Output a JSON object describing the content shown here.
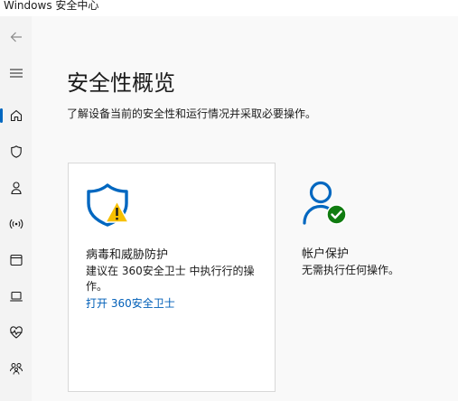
{
  "window": {
    "title": "Windows 安全中心"
  },
  "sidebar": {
    "items": [
      {
        "name": "back-arrow-icon"
      },
      {
        "name": "hamburger-menu-icon"
      },
      {
        "name": "home-icon"
      },
      {
        "name": "shield-icon"
      },
      {
        "name": "person-icon"
      },
      {
        "name": "wireless-icon"
      },
      {
        "name": "app-window-icon"
      },
      {
        "name": "laptop-icon"
      },
      {
        "name": "heart-pulse-icon"
      },
      {
        "name": "family-icon"
      }
    ]
  },
  "main": {
    "title": "安全性概览",
    "subtitle": "了解设备当前的安全性和运行情况并采取必要操作。",
    "cards": [
      {
        "title": "病毒和威胁防护",
        "description": "建议在 360安全卫士 中执行行的操作。",
        "link": "打开 360安全卫士",
        "status": "warning"
      },
      {
        "title": "帐户保护",
        "description": "无需执行任何操作。",
        "status": "ok"
      }
    ]
  },
  "colors": {
    "accent": "#0067c0",
    "link": "#005fb8",
    "warning": "#f7c000",
    "ok": "#107c10"
  }
}
